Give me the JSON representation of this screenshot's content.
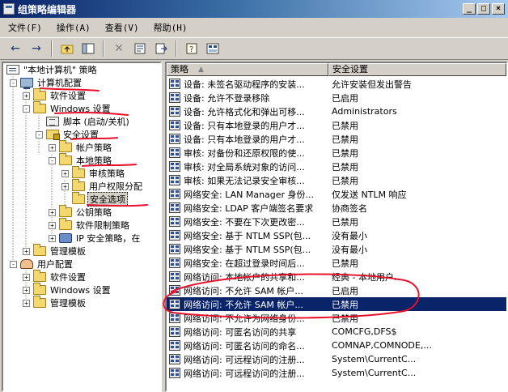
{
  "window": {
    "title": "组策略编辑器",
    "controls": [
      "minimize",
      "maximize",
      "close"
    ]
  },
  "menu": [
    {
      "label": "文件(F)"
    },
    {
      "label": "操作(A)"
    },
    {
      "label": "查看(V)"
    },
    {
      "label": "帮助(H)"
    }
  ],
  "toolbar": {
    "icons": [
      "back-arrow-icon",
      "forward-arrow-icon",
      "up-folder-icon",
      "show-tree-icon",
      "delete-icon",
      "properties-icon",
      "export-icon",
      "help-icon",
      "console-icon"
    ]
  },
  "tree": [
    {
      "label": "\"本地计算机\" 策略",
      "icon": "policy",
      "level": 0,
      "expanded": true
    },
    {
      "label": "计算机配置",
      "icon": "computer",
      "level": 1,
      "expanded": true
    },
    {
      "label": "软件设置",
      "icon": "folder",
      "level": 2,
      "expanded": false
    },
    {
      "label": "Windows 设置",
      "icon": "folder",
      "level": 2,
      "expanded": true
    },
    {
      "label": "脚本 (启动/关机)",
      "icon": "script",
      "level": 3,
      "expanded": null
    },
    {
      "label": "安全设置",
      "icon": "locked-folder",
      "level": 3,
      "expanded": true
    },
    {
      "label": "帐户策略",
      "icon": "folder",
      "level": 4,
      "expanded": false
    },
    {
      "label": "本地策略",
      "icon": "folder",
      "level": 4,
      "expanded": true
    },
    {
      "label": "审核策略",
      "icon": "folder",
      "level": 5,
      "expanded": false
    },
    {
      "label": "用户权限分配",
      "icon": "folder",
      "level": 5,
      "expanded": false
    },
    {
      "label": "安全选项",
      "icon": "folder",
      "level": 5,
      "expanded": null,
      "selected": true
    },
    {
      "label": "公钥策略",
      "icon": "folder",
      "level": 4,
      "expanded": false
    },
    {
      "label": "软件限制策略",
      "icon": "folder",
      "level": 4,
      "expanded": false
    },
    {
      "label": "IP 安全策略，在",
      "icon": "ipsec",
      "level": 4,
      "expanded": false
    },
    {
      "label": "管理模板",
      "icon": "folder",
      "level": 2,
      "expanded": false
    },
    {
      "label": "用户配置",
      "icon": "user",
      "level": 1,
      "expanded": true
    },
    {
      "label": "软件设置",
      "icon": "folder",
      "level": 2,
      "expanded": false
    },
    {
      "label": "Windows 设置",
      "icon": "folder",
      "level": 2,
      "expanded": false
    },
    {
      "label": "管理模板",
      "icon": "folder",
      "level": 2,
      "expanded": false
    }
  ],
  "list": {
    "columns": [
      "策略",
      "安全设置"
    ],
    "rows": [
      {
        "policy": "设备: 未签名驱动程序的安装...",
        "setting": "允许安装但发出警告"
      },
      {
        "policy": "设备: 允许不登录移除",
        "setting": "已启用"
      },
      {
        "policy": "设备: 允许格式化和弹出可移...",
        "setting": "Administrators"
      },
      {
        "policy": "设备: 只有本地登录的用户才...",
        "setting": "已禁用"
      },
      {
        "policy": "设备: 只有本地登录的用户才...",
        "setting": "已禁用"
      },
      {
        "policy": "审核: 对备份和还原权限的使...",
        "setting": "已禁用"
      },
      {
        "policy": "审核: 对全局系统对象的访问...",
        "setting": "已禁用"
      },
      {
        "policy": "审核: 如果无法记录安全审核...",
        "setting": "已禁用"
      },
      {
        "policy": "网络安全: LAN Manager 身份...",
        "setting": "仅发送 NTLM 响应"
      },
      {
        "policy": "网络安全: LDAP 客户端签名要求",
        "setting": "协商签名"
      },
      {
        "policy": "网络安全: 不要在下次更改密...",
        "setting": "已禁用"
      },
      {
        "policy": "网络安全: 基于 NTLM SSP(包...",
        "setting": "没有最小"
      },
      {
        "policy": "网络安全: 基于 NTLM SSP(包...",
        "setting": "没有最小"
      },
      {
        "policy": "网络安全: 在超过登录时间后...",
        "setting": "已禁用"
      },
      {
        "policy": "网络访问: 本地帐户的共享和...",
        "setting": "经典 - 本地用户..."
      },
      {
        "policy": "网络访问: 不允许 SAM 帐户...",
        "setting": "已启用"
      },
      {
        "policy": "网络访问: 不允许 SAM 帐户...",
        "setting": "已禁用",
        "selected": true
      },
      {
        "policy": "网络访问: 不允许为网络身份...",
        "setting": "已禁用"
      },
      {
        "policy": "网络访问: 可匿名访问的共享",
        "setting": "COMCFG,DFS$"
      },
      {
        "policy": "网络访问: 可匿名访问的命名...",
        "setting": "COMNAP,COMNODE,..."
      },
      {
        "policy": "网络访问: 可远程访问的注册...",
        "setting": "System\\CurrentC..."
      },
      {
        "policy": "网络访问: 可远程访问的注册...",
        "setting": "System\\CurrentC..."
      }
    ]
  },
  "annotation_color": "#e8102a"
}
